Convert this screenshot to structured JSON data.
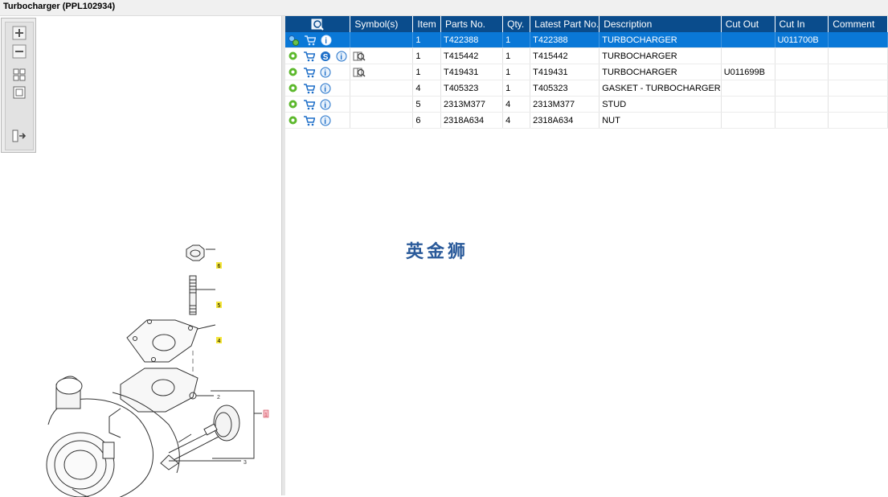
{
  "window": {
    "title": "Turbocharger (PPL102934)"
  },
  "toolbox": {
    "buttons": [
      "zoom-in",
      "zoom-out",
      "fit-all",
      "fit-page",
      "toggle-panel"
    ]
  },
  "table": {
    "columns": [
      "",
      "Symbol(s)",
      "Item",
      "Parts No.",
      "Qty.",
      "Latest Part No.",
      "Description",
      "Cut Out",
      "Cut In",
      "Comment"
    ],
    "rows": [
      {
        "item": "1",
        "part": "T422388",
        "qty": "1",
        "latest": "T422388",
        "desc": "TURBOCHARGER",
        "cutout": "",
        "cutin": "U011700B",
        "comment": "",
        "selected": true
      },
      {
        "item": "1",
        "part": "T415442",
        "qty": "1",
        "latest": "T415442",
        "desc": "TURBOCHARGER",
        "cutout": "",
        "cutin": "",
        "comment": ""
      },
      {
        "item": "1",
        "part": "T419431",
        "qty": "1",
        "latest": "T419431",
        "desc": "TURBOCHARGER",
        "cutout": "U011699B",
        "cutin": "",
        "comment": ""
      },
      {
        "item": "4",
        "part": "T405323",
        "qty": "1",
        "latest": "T405323",
        "desc": "GASKET - TURBOCHARGER",
        "cutout": "",
        "cutin": "",
        "comment": ""
      },
      {
        "item": "5",
        "part": "2313M377",
        "qty": "4",
        "latest": "2313M377",
        "desc": "STUD",
        "cutout": "",
        "cutin": "",
        "comment": ""
      },
      {
        "item": "6",
        "part": "2318A634",
        "qty": "4",
        "latest": "2318A634",
        "desc": "NUT",
        "cutout": "",
        "cutin": "",
        "comment": ""
      }
    ]
  },
  "diagram": {
    "callouts": [
      "6",
      "5",
      "4",
      "2",
      "1",
      "3"
    ]
  },
  "watermark": "英金狮",
  "colors": {
    "header": "#0a4c8c",
    "selected": "#0a78d7",
    "callout": "#f5e63a"
  }
}
